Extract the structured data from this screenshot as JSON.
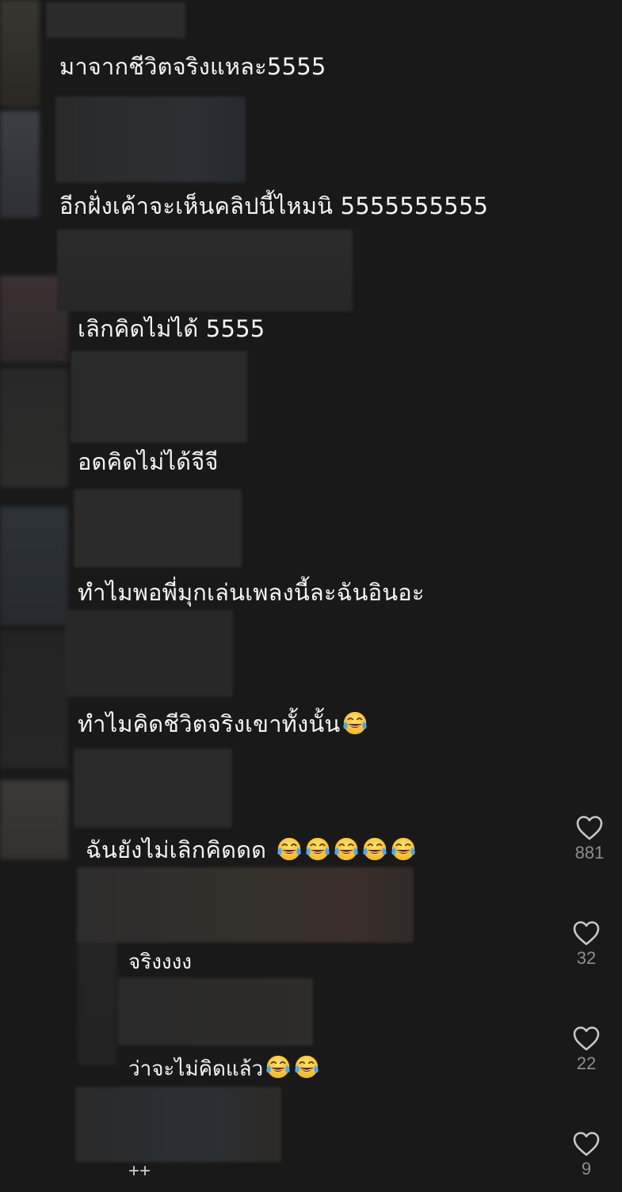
{
  "comments": [
    {
      "text": "มาจากชีวิตจริงแหละ5555",
      "emoji_count": 0
    },
    {
      "text": "อีกฝั่งเค้าจะเห็นคลิปนี้ไหมนิ 5555555555",
      "emoji_count": 0
    },
    {
      "text": "เลิกคิดไม่ได้ 5555",
      "emoji_count": 0
    },
    {
      "text": "อดคิดไม่ได้จีจี",
      "emoji_count": 0
    },
    {
      "text": "ทำไมพอพี่มุกเล่นเพลงนี้ละฉันอินอะ",
      "emoji_count": 0
    },
    {
      "text": "ทำไมคิดชีวิตจริงเขาทั้งนั้น",
      "emoji_count": 1
    },
    {
      "text": "ฉันยังไม่เลิกคิดดด ",
      "emoji_count": 5,
      "likes": "881"
    }
  ],
  "replies": [
    {
      "text": "จริงงงง",
      "emoji_count": 0,
      "likes": "32"
    },
    {
      "text": "ว่าจะไม่คิดแล้ว",
      "emoji_count": 2,
      "likes": "22"
    },
    {
      "text": "",
      "emoji_count": 0,
      "likes": "9"
    }
  ],
  "more_label": "++",
  "emoji": {
    "name": "face-with-tears-of-joy-icon"
  },
  "colors": {
    "background": "#191919",
    "text": "#f4f4f4",
    "count": "#8e8e8e",
    "heart_stroke": "#c8c8c8"
  }
}
